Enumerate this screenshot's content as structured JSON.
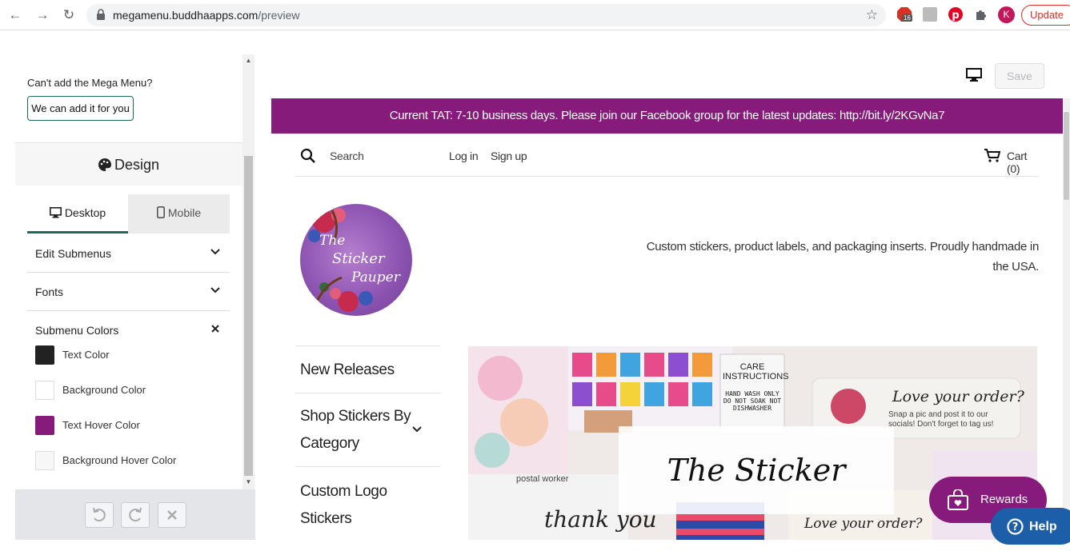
{
  "browser": {
    "url_host": "megamenu.buddhaapps.com",
    "url_path": "/preview",
    "badge_count": "16",
    "avatar_letter": "K",
    "update_label": "Update"
  },
  "sidebar": {
    "cant_add_text": "Can't add the Mega Menu?",
    "add_button_label": "We can add it for you",
    "design_title": "Design",
    "tabs": [
      {
        "label": "Desktop"
      },
      {
        "label": "Mobile"
      }
    ],
    "accordion": [
      {
        "label": "Edit Submenus"
      },
      {
        "label": "Fonts"
      },
      {
        "label": "Submenu Colors"
      }
    ],
    "colors": [
      {
        "label": "Text Color",
        "color": "#222222"
      },
      {
        "label": "Background Color",
        "color": "#ffffff"
      },
      {
        "label": "Text Hover Color",
        "color": "#861b7c"
      },
      {
        "label": "Background Hover Color",
        "color": "#f7f7f7"
      }
    ]
  },
  "toolbar": {
    "save_label": "Save"
  },
  "store": {
    "announcement": "Current TAT: 7-10 business days. Please join our Facebook group for the latest updates: http://bit.ly/2KGvNa7",
    "search_label": "Search",
    "login_label": "Log in",
    "signup_label": "Sign up",
    "cart_label": "Cart (0)",
    "tagline": "Custom stickers, product labels, and packaging inserts. Proudly handmade in the USA.",
    "logo_text_1": "The",
    "logo_text_2": "Sticker",
    "logo_text_3": "Pauper",
    "menu": [
      {
        "label": "New Releases"
      },
      {
        "label": "Shop Stickers By Category"
      },
      {
        "label": "Custom Logo Stickers"
      }
    ],
    "banner_title": "The Sticker Pauper",
    "banner_caption_1": "Love your order?",
    "banner_caption_2": "Snap a pic and post it to our socials! Don't forget to tag us!",
    "banner_caption_3": "CARE INSTRUCTIONS",
    "banner_caption_4": "HAND WASH ONLY DO NOT SOAK NOT DISHWASHER",
    "banner_caption_5": "thank you",
    "banner_caption_6": "postal worker",
    "banner_caption_7": "Love your order?"
  },
  "widgets": {
    "rewards_label": "Rewards",
    "help_label": "Help"
  },
  "colors": {
    "brand_purple": "#861b7c",
    "accent_green": "#1a6b5c",
    "help_blue": "#1c5fa8"
  }
}
